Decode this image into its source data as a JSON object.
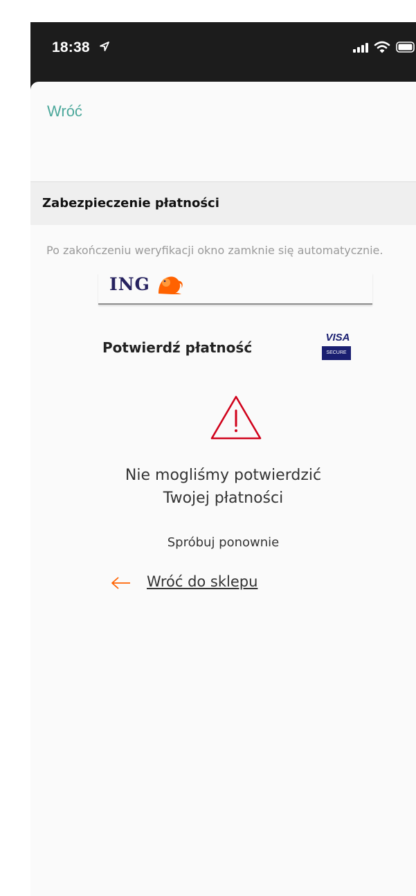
{
  "status_bar": {
    "time": "18:38",
    "icons": [
      "location-arrow-icon",
      "signal-icon",
      "wifi-icon",
      "battery-icon"
    ]
  },
  "nav": {
    "back_label": "Wróć"
  },
  "header": {
    "title": "Zabezpieczenie płatności"
  },
  "info": {
    "text": "Po zakończeniu weryfikacji okno zamknie się automatycznie."
  },
  "bank": {
    "logo_text": "ING",
    "confirm_title": "Potwierdź płatność",
    "visa_brand": "VISA",
    "visa_secure": "SECURE"
  },
  "error": {
    "line1": "Nie mogliśmy potwierdzić",
    "line2": "Twojej płatności",
    "retry": "Spróbuj ponownie"
  },
  "actions": {
    "return_label": "Wróć do sklepu"
  },
  "colors": {
    "accent_teal": "#4ca89b",
    "ing_orange": "#ff6200",
    "ing_navy": "#26225f",
    "warning_red": "#d0021b",
    "visa_blue": "#1a1f71"
  }
}
